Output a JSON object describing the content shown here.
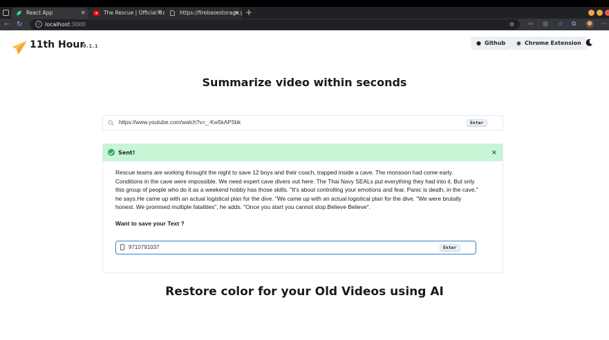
{
  "browser": {
    "tabs": [
      {
        "label": "React App",
        "favicon": "react-leaf-icon",
        "active": true
      },
      {
        "label": "The Rescue | Official Trail",
        "favicon": "youtube-icon",
        "active": false
      },
      {
        "label": "https://firebasestorage.go",
        "favicon": "page-icon",
        "active": false
      }
    ],
    "new_tab": "+",
    "close_glyph": "×",
    "address": {
      "host": "localhost",
      "port": ":3000"
    }
  },
  "header": {
    "brand": "11th Hour",
    "version": "v0.1.1",
    "github_label": "Github",
    "extension_label": "Chrome Extension",
    "theme_icon": "moon-icon"
  },
  "main": {
    "heading": "Summarize video within seconds",
    "search": {
      "value": "https://www.youtube.com/watch?v=_-Kw5kAPSbk",
      "enter": "Enter"
    },
    "alert": {
      "title": "Sent!",
      "close": "×"
    },
    "summary": "Rescue teams are working throught the night to save 12 boys and their coach, trapped inside a cave. The monsoon had come early. Conditions in the cave were impossible. We need expert cave divers out here. The Thai Navy SEALs put everything they had into it. But only this group of people who do it as a weekend hobby has those skills. \"It's about controlling your emotions and fear. Panic is death, in the cave,\" he says.He came up with an actual logistical plan for the dive. \"We came up with an actual logistical plan for the dive. \"We were brutally honest. We promised multiple fatalities\", he adds. \"Once you start you cannot stop.Believe Believe\".",
    "save_question": "Want to save your Text ?",
    "phone": {
      "value": "9710791037",
      "enter": "Enter"
    },
    "second_heading": "Restore color for your Old Videos using AI"
  },
  "colors": {
    "success_bg": "#c6f6d5",
    "success_icon": "#38a169",
    "focus": "#3182ce",
    "logo": "#f6c24a"
  }
}
